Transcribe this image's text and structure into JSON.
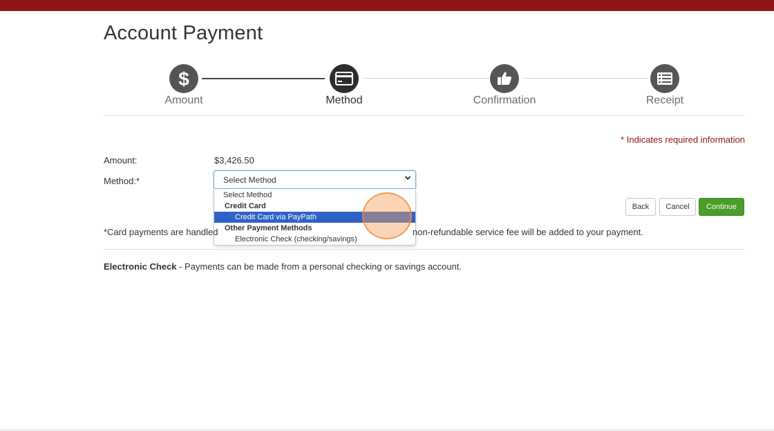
{
  "colors": {
    "header_bar": "#8f1414",
    "required": "#8f1414",
    "selected_option": "#2f62c5",
    "continue_button": "#4a9d2a"
  },
  "page": {
    "title": "Account Payment"
  },
  "stepper": {
    "steps": [
      {
        "label": "Amount",
        "icon": "dollar-icon",
        "state": "complete"
      },
      {
        "label": "Method",
        "icon": "credit-card-icon",
        "state": "active"
      },
      {
        "label": "Confirmation",
        "icon": "thumbs-up-icon",
        "state": "pending"
      },
      {
        "label": "Receipt",
        "icon": "list-icon",
        "state": "pending"
      }
    ]
  },
  "form": {
    "required_note": "* Indicates required information",
    "amount_label": "Amount:",
    "amount_value": "$3,426.50",
    "method_label": "Method:*",
    "method_selected": "Select Method",
    "dropdown": {
      "placeholder": "Select Method",
      "group_credit": "Credit Card",
      "option_credit_paypath": "Credit Card via PayPath",
      "group_other": "Other Payment Methods",
      "option_echeck": "Electronic Check (checking/savings)"
    }
  },
  "buttons": {
    "back": "Back",
    "cancel": "Cancel",
    "continue": "Continue"
  },
  "notes": {
    "card_fee_left": "*Card payments are handled",
    "card_fee_right": "non-refundable service fee will be added to your payment.",
    "echeck_title": "Electronic Check",
    "echeck_desc": " - Payments can be made from a personal checking or savings account."
  }
}
